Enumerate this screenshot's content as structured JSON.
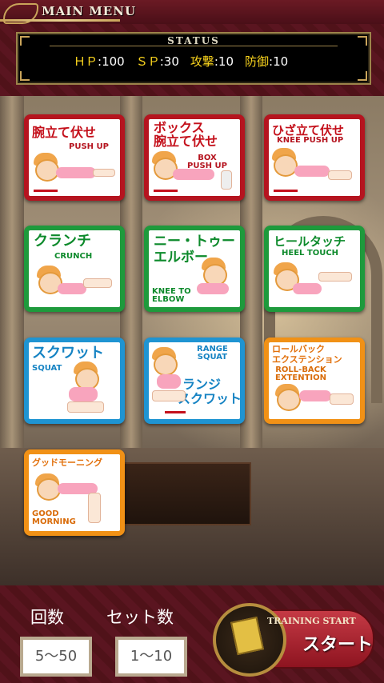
{
  "header": {
    "title": "MAIN MENU"
  },
  "status": {
    "heading": "STATUS",
    "hp_label": "ＨＰ",
    "hp_value": ":100",
    "sp_label": "ＳＰ",
    "sp_value": ":30",
    "atk_label": "攻撃",
    "atk_value": ":10",
    "def_label": "防御",
    "def_value": ":10"
  },
  "exercises": [
    {
      "jp": "腕立て伏せ",
      "en": "PUSH UP"
    },
    {
      "jp1": "ボックス",
      "jp2": "腕立て伏せ",
      "en1": "BOX",
      "en2": "PUSH UP"
    },
    {
      "jp": "ひざ立て伏せ",
      "en": "KNEE PUSH UP"
    },
    {
      "jp": "クランチ",
      "en": "CRUNCH"
    },
    {
      "jp1": "ニー・トゥー",
      "jp2": "エルボー",
      "en1": "KNEE TO",
      "en2": "ELBOW"
    },
    {
      "jp": "ヒールタッチ",
      "en": "HEEL TOUCH"
    },
    {
      "jp": "スクワット",
      "en": "SQUAT"
    },
    {
      "jp1": "ランジ",
      "jp2": "スクワット",
      "en1": "RANGE",
      "en2": "SQUAT"
    },
    {
      "jp1": "ロールバック",
      "jp2": "エクステンション",
      "en1": "ROLL-BACK",
      "en2": "EXTENTION"
    },
    {
      "jp": "グッドモーニング",
      "en1": "GOOD",
      "en2": "MORNING"
    }
  ],
  "controls": {
    "reps_label": "回数",
    "reps_value": "5〜50",
    "sets_label": "セット数",
    "sets_value": "1〜10",
    "start_en": "TRAINING START",
    "start_jp": "スタート"
  }
}
